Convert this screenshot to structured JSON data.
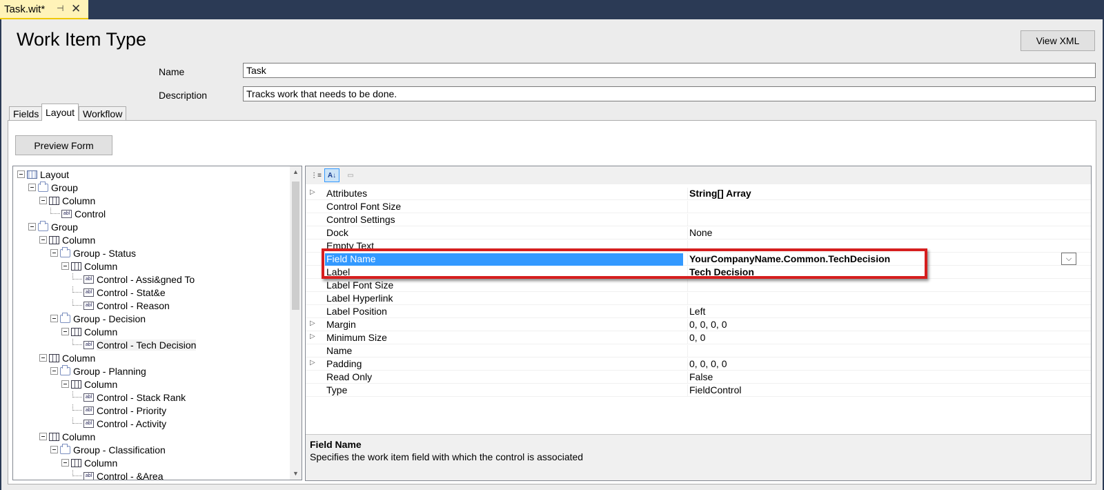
{
  "document_tab": {
    "title": "Task.wit*",
    "pin": "⊣",
    "close": "✕"
  },
  "header": {
    "title": "Work Item Type",
    "view_xml_label": "View XML"
  },
  "form": {
    "name_label": "Name",
    "name_value": "Task",
    "description_label": "Description",
    "description_value": "Tracks work that needs to be done."
  },
  "tabs": [
    {
      "label": "Fields",
      "selected": false
    },
    {
      "label": "Layout",
      "selected": true
    },
    {
      "label": "Workflow",
      "selected": false
    }
  ],
  "layout_tab": {
    "preview_form_label": "Preview Form"
  },
  "tree": [
    {
      "label": "Layout",
      "type": "layout",
      "expander": true
    },
    {
      "label": "Group",
      "type": "group",
      "expander": true
    },
    {
      "label": "Column",
      "type": "column",
      "expander": true
    },
    {
      "label": "Control",
      "type": "control",
      "expander": false
    },
    {
      "label": "Group",
      "type": "group",
      "expander": true
    },
    {
      "label": "Column",
      "type": "column",
      "expander": true
    },
    {
      "label": "Group - Status",
      "type": "group",
      "expander": true
    },
    {
      "label": "Column",
      "type": "column",
      "expander": true
    },
    {
      "label": "Control - Assi&gned To",
      "type": "control",
      "expander": false
    },
    {
      "label": "Control - Stat&e",
      "type": "control",
      "expander": false
    },
    {
      "label": "Control - Reason",
      "type": "control",
      "expander": false
    },
    {
      "label": "Group - Decision",
      "type": "group",
      "expander": true
    },
    {
      "label": "Column",
      "type": "column",
      "expander": true
    },
    {
      "label": "Control - Tech Decision",
      "type": "control",
      "expander": false,
      "selected": true
    },
    {
      "label": "Column",
      "type": "column",
      "expander": true
    },
    {
      "label": "Group - Planning",
      "type": "group",
      "expander": true
    },
    {
      "label": "Column",
      "type": "column",
      "expander": true
    },
    {
      "label": "Control - Stack Rank",
      "type": "control",
      "expander": false
    },
    {
      "label": "Control - Priority",
      "type": "control",
      "expander": false
    },
    {
      "label": "Control - Activity",
      "type": "control",
      "expander": false
    },
    {
      "label": "Column",
      "type": "column",
      "expander": true
    },
    {
      "label": "Group - Classification",
      "type": "group",
      "expander": true
    },
    {
      "label": "Column",
      "type": "column",
      "expander": true
    },
    {
      "label": "Control - &Area",
      "type": "control",
      "expander": false
    }
  ],
  "control_icon_text": "abl",
  "properties": [
    {
      "name": "Attributes",
      "value": "String[] Array",
      "expandable": true,
      "bold": true
    },
    {
      "name": "Control Font Size",
      "value": "",
      "expandable": false
    },
    {
      "name": "Control Settings",
      "value": "",
      "expandable": false
    },
    {
      "name": "Dock",
      "value": "None",
      "expandable": false
    },
    {
      "name": "Empty Text",
      "value": "",
      "expandable": false
    },
    {
      "name": "Field Name",
      "value": "YourCompanyName.Common.TechDecision",
      "expandable": false,
      "bold": true,
      "selected": true
    },
    {
      "name": "Label",
      "value": "Tech Decision",
      "expandable": false,
      "bold": true
    },
    {
      "name": "Label Font Size",
      "value": "",
      "expandable": false
    },
    {
      "name": "Label Hyperlink",
      "value": "",
      "expandable": false
    },
    {
      "name": "Label Position",
      "value": "Left",
      "expandable": false
    },
    {
      "name": "Margin",
      "value": "0, 0, 0, 0",
      "expandable": true
    },
    {
      "name": "Minimum Size",
      "value": "0, 0",
      "expandable": true
    },
    {
      "name": "Name",
      "value": "",
      "expandable": false
    },
    {
      "name": "Padding",
      "value": "0, 0, 0, 0",
      "expandable": true
    },
    {
      "name": "Read Only",
      "value": "False",
      "expandable": false
    },
    {
      "name": "Type",
      "value": "FieldControl",
      "expandable": false
    }
  ],
  "description_pane": {
    "title": "Field Name",
    "text": "Specifies the work item field with which the control is associated"
  },
  "colors": {
    "selection": "#3399ff",
    "highlight_box": "#d61e1e",
    "tab_active": "#fff3b8"
  }
}
